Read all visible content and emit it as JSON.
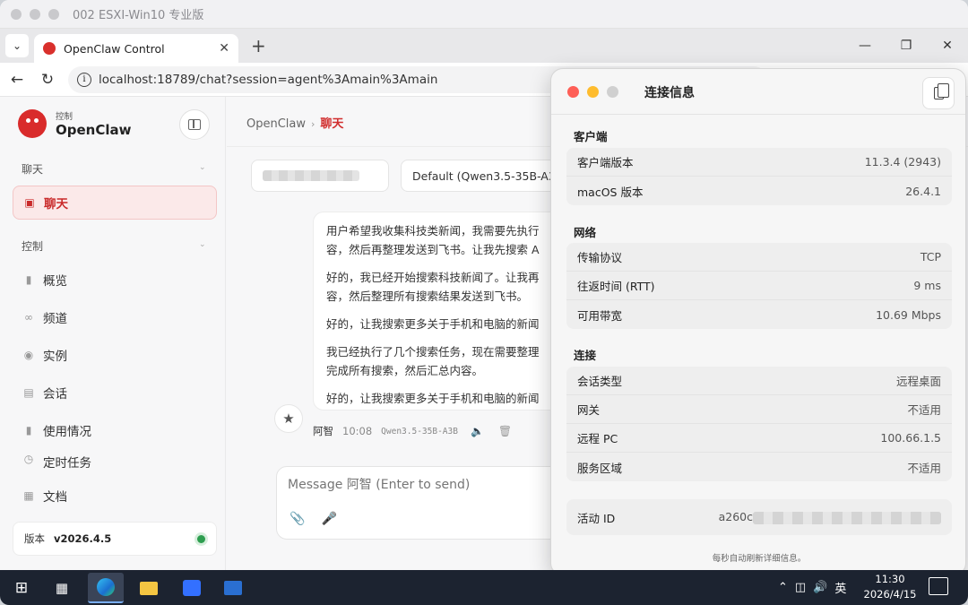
{
  "window": {
    "title": "002 ESXI-Win10 专业版"
  },
  "browser": {
    "tab_title": "OpenClaw Control",
    "url": "localhost:18789/chat?session=agent%3Amain%3Amain",
    "new_tab_symbol": "+",
    "close_symbol": "✕"
  },
  "sidebar": {
    "brand_small": "控制",
    "brand_name": "OpenClaw",
    "group_chat": "聊天",
    "group_control": "控制",
    "items": [
      {
        "label": "聊天",
        "icon": "chat-bubble-icon",
        "active": true
      },
      {
        "label": "概览",
        "icon": "bar-chart-icon"
      },
      {
        "label": "频道",
        "icon": "link-icon"
      },
      {
        "label": "实例",
        "icon": "broadcast-icon"
      },
      {
        "label": "会话",
        "icon": "document-icon"
      },
      {
        "label": "使用情况",
        "icon": "bar-chart-icon"
      },
      {
        "label": "定时任务",
        "icon": "clock-icon"
      },
      {
        "label": "文档",
        "icon": "book-icon"
      }
    ],
    "version_label": "版本",
    "version_value": "v2026.4.5",
    "status_color": "#2d9e4f"
  },
  "main": {
    "breadcrumb_root": "OpenClaw",
    "breadcrumb_sep": "›",
    "breadcrumb_current": "聊天",
    "model_select": "Default (Qwen3.5-35B-A3...",
    "messages": [
      "用户希望我收集科技类新闻，我需要先执行",
      "容，然后再整理发送到飞书。让我先搜索 A",
      "好的，我已经开始搜索科技新闻了。让我再",
      "容，然后整理所有搜索结果发送到飞书。",
      "好的，让我搜索更多关于手机和电脑的新闻",
      "我已经执行了几个搜索任务，现在需要整理",
      "完成所有搜索，然后汇总内容。",
      "好的，让我搜索更多关于手机和电脑的新闻"
    ],
    "message_sender": "阿智",
    "message_time": "10:08",
    "message_model": "Qwen3.5-35B-A3B",
    "composer_placeholder": "Message 阿智 (Enter to send)",
    "accent_color": "#d12e2e"
  },
  "connection_panel": {
    "title": "连接信息",
    "sections": [
      {
        "title": "客户端",
        "rows": [
          {
            "key": "客户端版本",
            "value": "11.3.4 (2943)"
          },
          {
            "key": "macOS 版本",
            "value": "26.4.1"
          }
        ]
      },
      {
        "title": "网络",
        "rows": [
          {
            "key": "传输协议",
            "value": "TCP"
          },
          {
            "key": "往返时间 (RTT)",
            "value": "9 ms"
          },
          {
            "key": "可用带宽",
            "value": "10.69 Mbps"
          }
        ]
      },
      {
        "title": "连接",
        "rows": [
          {
            "key": "会话类型",
            "value": "远程桌面"
          },
          {
            "key": "网关",
            "value": "不适用"
          },
          {
            "key": "远程 PC",
            "value": "100.66.1.5"
          },
          {
            "key": "服务区域",
            "value": "不适用"
          }
        ]
      }
    ],
    "activity_id_label": "活动 ID",
    "activity_id_prefix": "a260c",
    "footer": "每秒自动刷新详细信息。"
  },
  "taskbar": {
    "ime": "英",
    "time": "11:30",
    "date": "2026/4/15"
  }
}
